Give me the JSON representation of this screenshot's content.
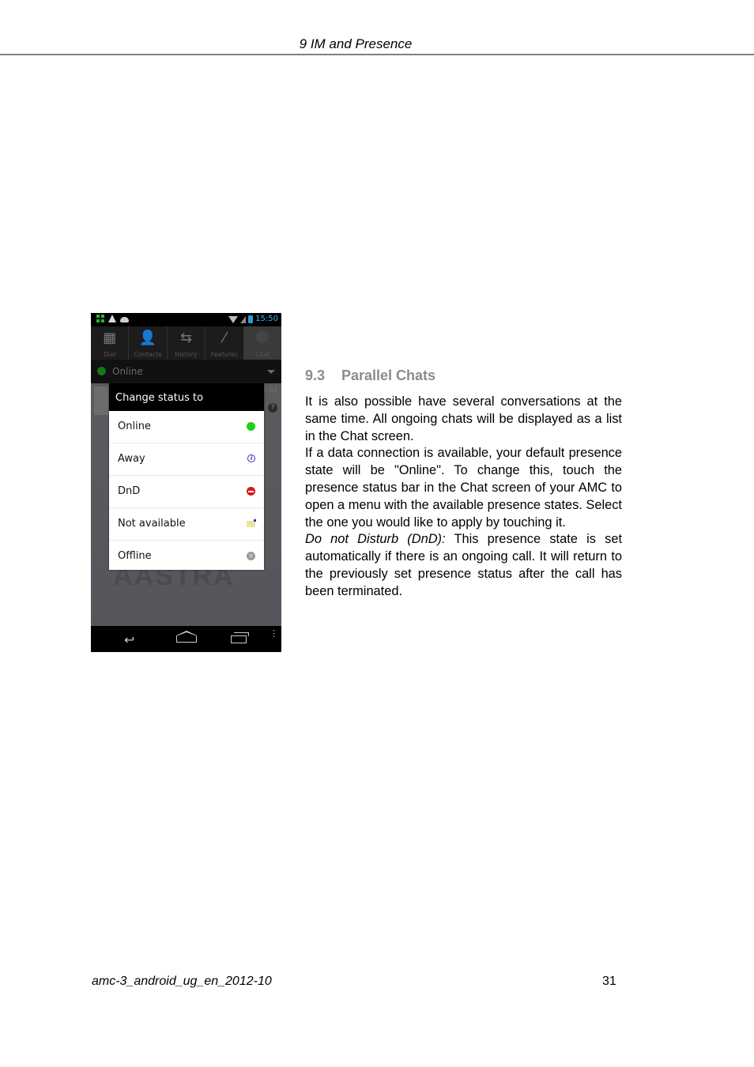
{
  "header": {
    "running_title": "9  IM and Presence"
  },
  "phone": {
    "statusbar": {
      "time": "15:50",
      "left_icons": [
        "apps-grid-icon",
        "warning-icon",
        "android-icon"
      ],
      "right_icons": [
        "wifi-icon",
        "signal-icon",
        "battery-icon"
      ]
    },
    "tabs": [
      {
        "label": "Dial",
        "icon": "dialpad-icon",
        "glyph": "▦"
      },
      {
        "label": "Contacts",
        "icon": "person-icon",
        "glyph": "👤"
      },
      {
        "label": "History",
        "icon": "arrows-icon",
        "glyph": "⇆"
      },
      {
        "label": "Features",
        "icon": "wand-icon",
        "glyph": "⁄"
      },
      {
        "label": "Chat",
        "icon": "chat-icon",
        "glyph": ""
      }
    ],
    "active_tab": "Chat",
    "presence_bar": {
      "label": "Online",
      "dot_color": "#0f7a0f"
    },
    "background_list": {
      "time": "5:41",
      "help": "?",
      "logo": "AASTRA"
    },
    "dialog": {
      "title": "Change status to",
      "options": [
        {
          "label": "Online",
          "icon": "online-icon",
          "color": "#1fd11f"
        },
        {
          "label": "Away",
          "icon": "away-icon",
          "glyph": "i",
          "color": "#3a2fb8"
        },
        {
          "label": "DnD",
          "icon": "dnd-icon",
          "color": "#d61a1a"
        },
        {
          "label": "Not available",
          "icon": "not-available-icon",
          "color": "#e8e69a"
        },
        {
          "label": "Offline",
          "icon": "offline-icon",
          "glyph": "✕",
          "color": "#9a9a9a"
        }
      ]
    },
    "navbar": {
      "back": "↩",
      "menu": "⋮"
    }
  },
  "section": {
    "number": "9.3",
    "title": "Parallel Chats",
    "paragraphs": [
      "It is also possible have several conversations at the same time.  All ongoing chats will be displayed as a list in the Chat screen.",
      "If a data connection is available, your default presence state will be \"Online\".  To change this, touch the presence status bar in the Chat screen of your AMC to open a menu with the available presence states. Select the one you would like to apply by touching it."
    ],
    "note_label": "Do not Disturb (DnD):",
    "note_text": " This presence state is set automatically if there is an ongoing call. It will return to the previously set presence status after the call has been terminated."
  },
  "footer": {
    "document_id": "amc-3_android_ug_en_2012-10",
    "page_number": "31"
  }
}
